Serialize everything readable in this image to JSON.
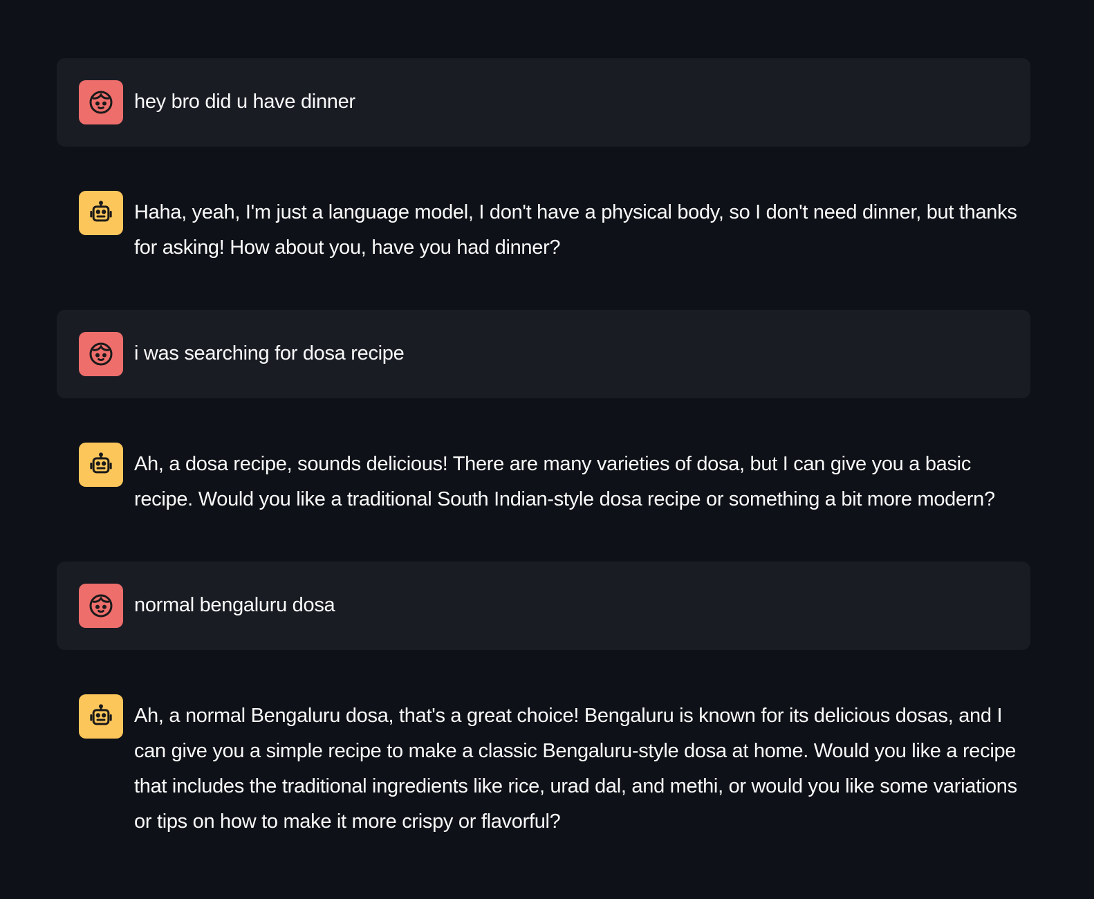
{
  "colors": {
    "background": "#0e1117",
    "user_bubble": "#1a1c24",
    "user_avatar": "#ee6e6c",
    "assistant_avatar": "#fdc65b",
    "text": "#fafafa"
  },
  "messages": [
    {
      "role": "user",
      "icon": "face-icon",
      "text": "hey bro did u have dinner"
    },
    {
      "role": "assistant",
      "icon": "robot-icon",
      "text": "Haha, yeah, I'm just a language model, I don't have a physical body, so I don't need dinner, but thanks for asking! How about you, have you had dinner?"
    },
    {
      "role": "user",
      "icon": "face-icon",
      "text": "i was searching for dosa recipe"
    },
    {
      "role": "assistant",
      "icon": "robot-icon",
      "text": "Ah, a dosa recipe, sounds delicious! There are many varieties of dosa, but I can give you a basic recipe. Would you like a traditional South Indian-style dosa recipe or something a bit more modern?"
    },
    {
      "role": "user",
      "icon": "face-icon",
      "text": "normal bengaluru dosa"
    },
    {
      "role": "assistant",
      "icon": "robot-icon",
      "text": "Ah, a normal Bengaluru dosa, that's a great choice! Bengaluru is known for its delicious dosas, and I can give you a simple recipe to make a classic Bengaluru-style dosa at home. Would you like a recipe that includes the traditional ingredients like rice, urad dal, and methi, or would you like some variations or tips on how to make it more crispy or flavorful?"
    }
  ]
}
